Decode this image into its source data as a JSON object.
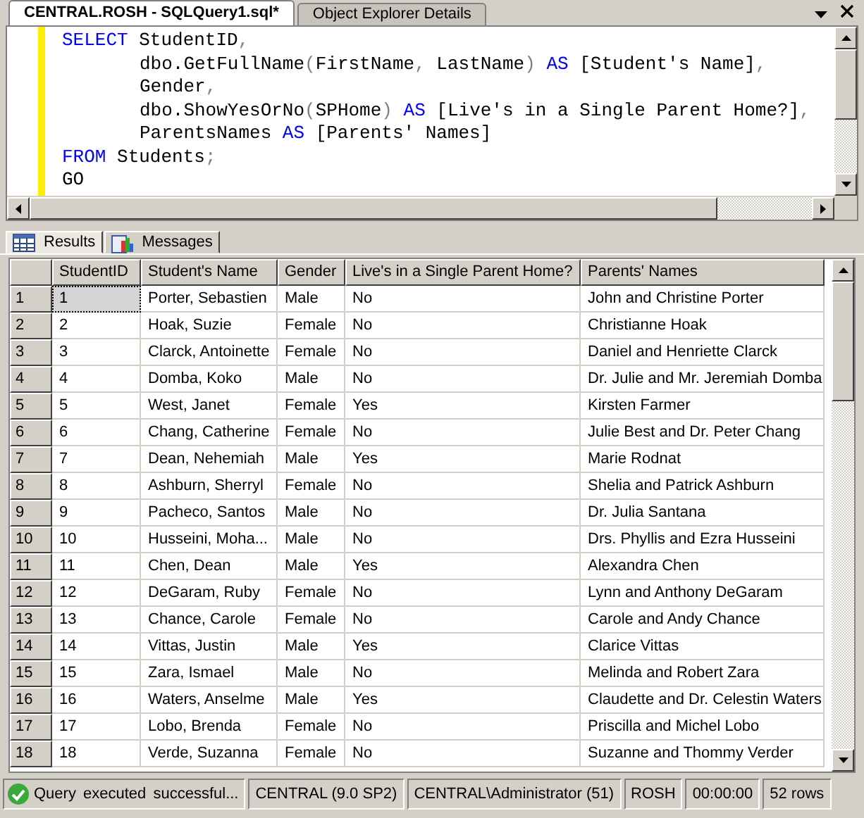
{
  "doc_tabs": [
    {
      "label": "CENTRAL.ROSH - SQLQuery1.sql*",
      "selected": true
    },
    {
      "label": "Object Explorer Details",
      "selected": false
    }
  ],
  "editor": {
    "lines": [
      {
        "indented": false,
        "segments": [
          {
            "kind": "keyword",
            "text": "SELECT"
          },
          {
            "kind": "text",
            "text": " StudentID"
          },
          {
            "kind": "operator",
            "text": ","
          }
        ]
      },
      {
        "indented": true,
        "segments": [
          {
            "kind": "text",
            "text": "dbo.GetFullName"
          },
          {
            "kind": "operator",
            "text": "("
          },
          {
            "kind": "text",
            "text": "FirstName"
          },
          {
            "kind": "operator",
            "text": ", "
          },
          {
            "kind": "text",
            "text": "LastName"
          },
          {
            "kind": "operator",
            "text": ") "
          },
          {
            "kind": "keyword",
            "text": "AS"
          },
          {
            "kind": "text",
            "text": " [Student's Name]"
          },
          {
            "kind": "operator",
            "text": ","
          }
        ]
      },
      {
        "indented": true,
        "segments": [
          {
            "kind": "text",
            "text": "Gender"
          },
          {
            "kind": "operator",
            "text": ","
          }
        ]
      },
      {
        "indented": true,
        "segments": [
          {
            "kind": "text",
            "text": "dbo.ShowYesOrNo"
          },
          {
            "kind": "operator",
            "text": "("
          },
          {
            "kind": "text",
            "text": "SPHome"
          },
          {
            "kind": "operator",
            "text": ") "
          },
          {
            "kind": "keyword",
            "text": "AS"
          },
          {
            "kind": "text",
            "text": " [Live's in a Single Parent Home?]"
          },
          {
            "kind": "operator",
            "text": ","
          }
        ]
      },
      {
        "indented": true,
        "segments": [
          {
            "kind": "text",
            "text": "ParentsNames "
          },
          {
            "kind": "keyword",
            "text": "AS"
          },
          {
            "kind": "text",
            "text": " [Parents' Names]"
          }
        ]
      },
      {
        "indented": false,
        "segments": [
          {
            "kind": "keyword",
            "text": "FROM"
          },
          {
            "kind": "text",
            "text": " Students"
          },
          {
            "kind": "operator",
            "text": ";"
          }
        ]
      },
      {
        "indented": false,
        "segments": [
          {
            "kind": "text",
            "text": "GO"
          }
        ]
      }
    ]
  },
  "result_tabs": [
    {
      "label": "Results",
      "selected": true
    },
    {
      "label": "Messages",
      "selected": false
    }
  ],
  "table": {
    "columns": [
      "StudentID",
      "Student's Name",
      "Gender",
      "Live's in a Single Parent Home?",
      "Parents' Names"
    ],
    "rows": [
      {
        "row_number": "1",
        "cells": [
          "1",
          "Porter, Sebastien",
          "Male",
          "No",
          "John and Christine Porter"
        ],
        "selected": true
      },
      {
        "row_number": "2",
        "cells": [
          "2",
          "Hoak, Suzie",
          "Female",
          "No",
          "Christianne Hoak"
        ],
        "selected": false
      },
      {
        "row_number": "3",
        "cells": [
          "3",
          "Clarck, Antoinette",
          "Female",
          "No",
          "Daniel and Henriette Clarck"
        ],
        "selected": false
      },
      {
        "row_number": "4",
        "cells": [
          "4",
          "Domba, Koko",
          "Male",
          "No",
          "Dr. Julie and Mr. Jeremiah Domba"
        ],
        "selected": false
      },
      {
        "row_number": "5",
        "cells": [
          "5",
          "West, Janet",
          "Female",
          "Yes",
          "Kirsten Farmer"
        ],
        "selected": false
      },
      {
        "row_number": "6",
        "cells": [
          "6",
          "Chang, Catherine",
          "Female",
          "No",
          "Julie Best and Dr. Peter Chang"
        ],
        "selected": false
      },
      {
        "row_number": "7",
        "cells": [
          "7",
          "Dean, Nehemiah",
          "Male",
          "Yes",
          "Marie Rodnat"
        ],
        "selected": false
      },
      {
        "row_number": "8",
        "cells": [
          "8",
          "Ashburn, Sherryl",
          "Female",
          "No",
          "Shelia and Patrick Ashburn"
        ],
        "selected": false
      },
      {
        "row_number": "9",
        "cells": [
          "9",
          "Pacheco, Santos",
          "Male",
          "No",
          "Dr. Julia Santana"
        ],
        "selected": false
      },
      {
        "row_number": "10",
        "cells": [
          "10",
          "Husseini, Moha...",
          "Male",
          "No",
          "Drs. Phyllis and Ezra Husseini"
        ],
        "selected": false
      },
      {
        "row_number": "11",
        "cells": [
          "11",
          "Chen, Dean",
          "Male",
          "Yes",
          "Alexandra Chen"
        ],
        "selected": false
      },
      {
        "row_number": "12",
        "cells": [
          "12",
          "DeGaram, Ruby",
          "Female",
          "No",
          "Lynn and Anthony DeGaram"
        ],
        "selected": false
      },
      {
        "row_number": "13",
        "cells": [
          "13",
          "Chance, Carole",
          "Female",
          "No",
          "Carole and Andy Chance"
        ],
        "selected": false
      },
      {
        "row_number": "14",
        "cells": [
          "14",
          "Vittas, Justin",
          "Male",
          "Yes",
          "Clarice Vittas"
        ],
        "selected": false
      },
      {
        "row_number": "15",
        "cells": [
          "15",
          "Zara, Ismael",
          "Male",
          "No",
          "Melinda and Robert Zara"
        ],
        "selected": false
      },
      {
        "row_number": "16",
        "cells": [
          "16",
          "Waters, Anselme",
          "Male",
          "Yes",
          "Claudette and Dr. Celestin Waters"
        ],
        "selected": false
      },
      {
        "row_number": "17",
        "cells": [
          "17",
          "Lobo, Brenda",
          "Female",
          "No",
          "Priscilla and Michel Lobo"
        ],
        "selected": false
      },
      {
        "row_number": "18",
        "cells": [
          "18",
          "Verde, Suzanna",
          "Female",
          "No",
          "Suzanne and Thommy Verder"
        ],
        "selected": false
      }
    ]
  },
  "status_bar": {
    "message": "Query executed successful...",
    "cells": [
      "CENTRAL (9.0 SP2)",
      "CENTRAL\\Administrator (51)",
      "ROSH",
      "00:00:00",
      "52 rows"
    ]
  }
}
